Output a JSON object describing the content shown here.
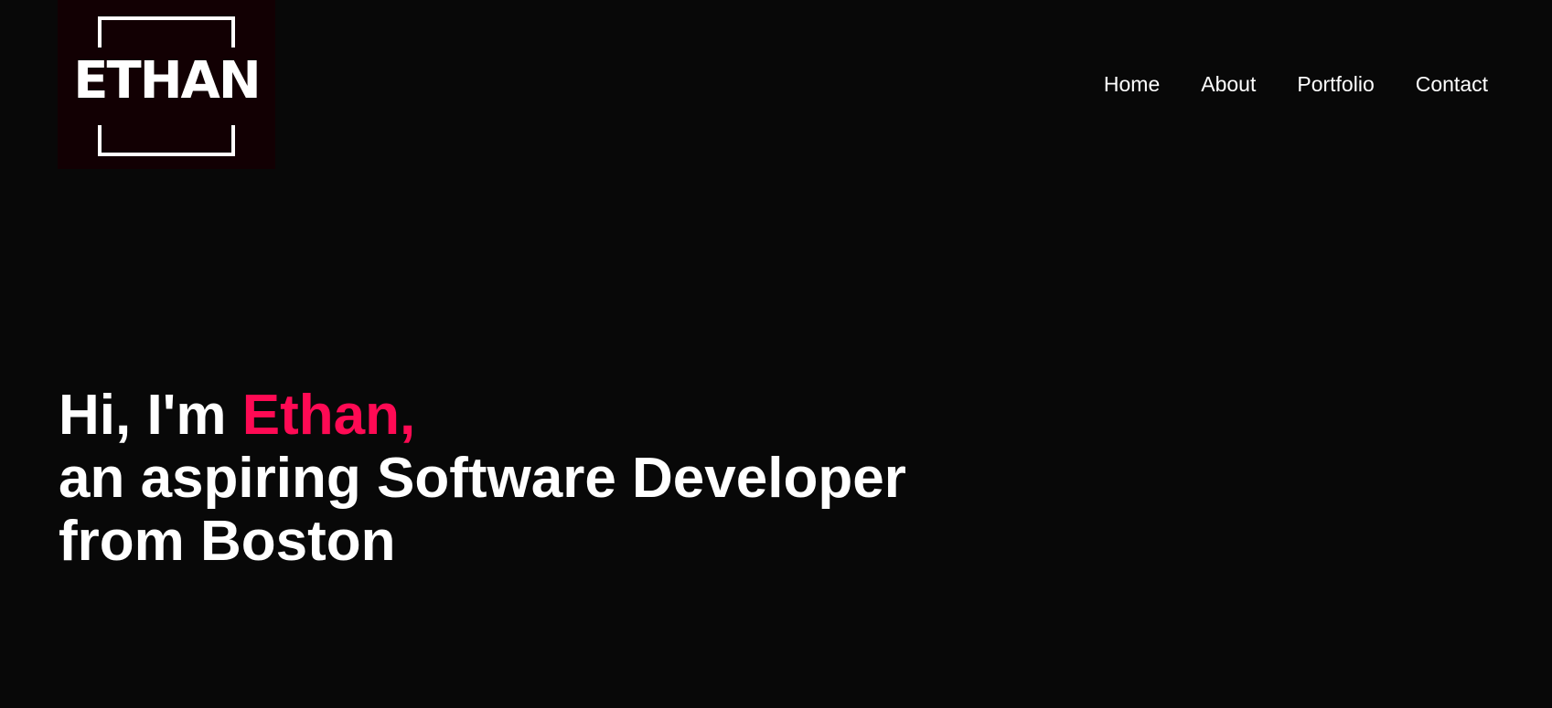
{
  "logo": {
    "text": "ETHAN",
    "background": "#120003"
  },
  "nav": {
    "items": [
      {
        "label": "Home"
      },
      {
        "label": "About"
      },
      {
        "label": "Portfolio"
      },
      {
        "label": "Contact"
      }
    ]
  },
  "hero": {
    "greeting": "Hi, I'm ",
    "name": "Ethan,",
    "line2": "an aspiring Software Developer",
    "line3": "from Boston"
  },
  "colors": {
    "background": "#080808",
    "text": "#ffffff",
    "accent": "#ff0a54"
  }
}
